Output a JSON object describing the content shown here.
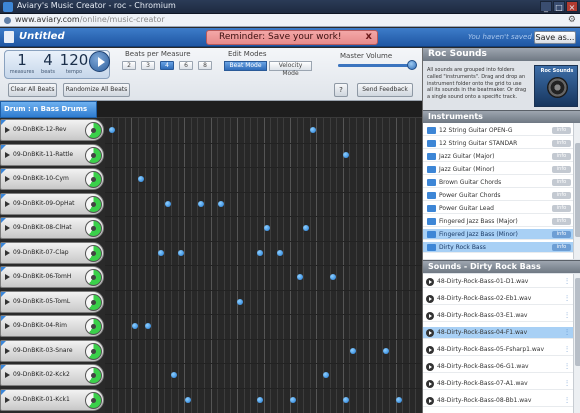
{
  "browser": {
    "title": "Aviary's Music Creator - roc - Chromium",
    "url_domain": "www.aviary.com",
    "url_path": "/online/music-creator"
  },
  "header": {
    "doc_title": "Untitled",
    "reminder": "Reminder: Save your work!",
    "reminder_close": "x",
    "not_saved": "You haven't saved yet",
    "save_as": "Save as..."
  },
  "transport": {
    "measures": "1",
    "measures_label": "measures",
    "beats": "4",
    "beats_label": "beats",
    "tempo": "120",
    "tempo_label": "tempo"
  },
  "beats_per_measure": {
    "label": "Beats per Measure",
    "options": [
      "2",
      "3",
      "4",
      "6",
      "8"
    ],
    "selected": "4"
  },
  "edit_modes": {
    "label": "Edit Modes",
    "beat": "Beat Mode",
    "velocity": "Velocity Mode",
    "selected": "Beat Mode"
  },
  "master_volume": {
    "label": "Master Volume",
    "level": 0.92
  },
  "actions": {
    "clear": "Clear All Beats",
    "randomize": "Randomize All Beats",
    "help": "?",
    "feedback": "Send Feedback"
  },
  "drum": {
    "header": "Drum : n Bass Drums"
  },
  "tracks": [
    {
      "name": "09-DnBKit-12-Rev"
    },
    {
      "name": "09-DnBKit-11-Rattle"
    },
    {
      "name": "09-DnBKit-10-Cym"
    },
    {
      "name": "09-DnBKit-09-OpHat"
    },
    {
      "name": "09-DnBKit-08-ClHat"
    },
    {
      "name": "09-DnBKit-07-Clap"
    },
    {
      "name": "09-DnBKit-06-TomH"
    },
    {
      "name": "09-DnBKit-05-TomL"
    },
    {
      "name": "09-DnBKit-04-Rim"
    },
    {
      "name": "09-DnBKit-03-Snare"
    },
    {
      "name": "09-DnBKit-02-Kck2"
    },
    {
      "name": "09-DnBKit-01-Kck1"
    }
  ],
  "beats": [
    [
      0.5,
      31
    ],
    [
      36
    ],
    [
      5
    ],
    [
      9,
      14,
      17
    ],
    [
      24,
      30
    ],
    [
      8,
      11,
      23,
      26
    ],
    [
      29,
      34
    ],
    [
      20
    ],
    [
      4,
      6
    ],
    [
      37,
      42
    ],
    [
      10,
      33
    ],
    [
      12,
      23,
      28,
      36,
      44
    ]
  ],
  "beat_columns": 48,
  "panel": {
    "title": "Roc Sounds",
    "description": "All sounds are grouped into folders called \"instruments\". Drag and drop an instrument folder onto the grid to use all its sounds in the beatmaker. Or drag a single sound onto a specific track.",
    "artist_name": "Roc Sounds",
    "instruments_title": "Instruments",
    "instruments": [
      {
        "name": "12 String Guitar OPEN-G",
        "badge": "info"
      },
      {
        "name": "12 String Guitar STANDAR",
        "badge": "info"
      },
      {
        "name": "Jazz Guitar (Major)",
        "badge": "info"
      },
      {
        "name": "Jazz Guitar (Minor)",
        "badge": "info"
      },
      {
        "name": "Brown Guitar Chords",
        "badge": "info"
      },
      {
        "name": "Power Guitar Chords",
        "badge": "info"
      },
      {
        "name": "Power Guitar Lead",
        "badge": "info"
      },
      {
        "name": "Fingered Jazz Bass (Major)",
        "badge": "info"
      },
      {
        "name": "Fingered Jazz Bass (Minor)",
        "badge": "info",
        "selected": true
      },
      {
        "name": "Dirty Rock Bass",
        "badge": "info",
        "selected": true
      }
    ],
    "sounds_title": "Sounds - Dirty Rock Bass",
    "sounds": [
      {
        "name": "48-Dirty-Rock-Bass-01-D1.wav"
      },
      {
        "name": "48-Dirty-Rock-Bass-02-Eb1.wav"
      },
      {
        "name": "48-Dirty-Rock-Bass-03-E1.wav"
      },
      {
        "name": "48-Dirty-Rock-Bass-04-F1.wav",
        "selected": true
      },
      {
        "name": "48-Dirty-Rock-Bass-05-Fsharp1.wav"
      },
      {
        "name": "48-Dirty-Rock-Bass-06-G1.wav"
      },
      {
        "name": "48-Dirty-Rock-Bass-07-A1.wav"
      },
      {
        "name": "48-Dirty-Rock-Bass-08-Bb1.wav"
      }
    ]
  }
}
